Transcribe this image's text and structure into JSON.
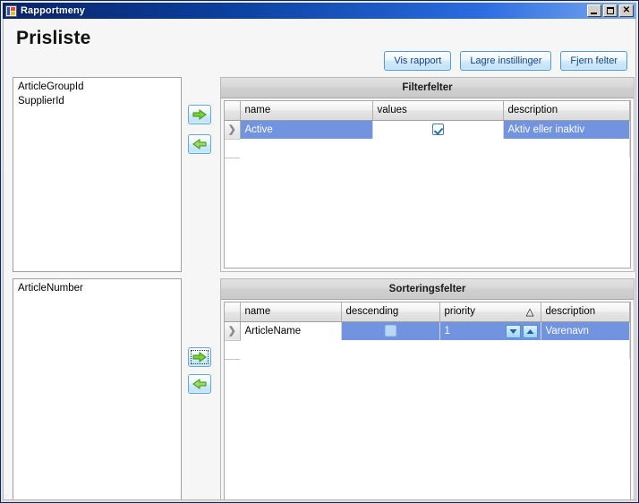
{
  "window": {
    "title": "Rapportmeny",
    "icon": "report-window-icon",
    "controls": {
      "minimize": "minimize-button",
      "maximize": "maximize-button",
      "close": "close-button",
      "close_glyph": "✕"
    }
  },
  "page": {
    "title": "Prisliste"
  },
  "toolbar": {
    "buttons": [
      {
        "label": "Vis rapport",
        "name": "show-report-button"
      },
      {
        "label": "Lagre instillinger",
        "name": "save-settings-button"
      },
      {
        "label": "Fjern felter",
        "name": "clear-fields-button"
      }
    ]
  },
  "available_filters": {
    "name": "available-filter-fields-list",
    "items": [
      "ArticleGroupId",
      "SupplierId"
    ]
  },
  "available_sortfields": {
    "name": "available-sort-fields-list",
    "items": [
      "ArticleNumber"
    ]
  },
  "transfer_buttons": {
    "filter_add": "add-filter-field-button",
    "filter_remove": "remove-filter-field-button",
    "sort_add": "add-sort-field-button",
    "sort_remove": "remove-sort-field-button",
    "add_glyph": "arrow-right-green-icon",
    "remove_glyph": "arrow-left-green-icon"
  },
  "filter_panel": {
    "caption": "Filterfelter",
    "columns": [
      "name",
      "values",
      "description"
    ],
    "rows": [
      {
        "selected": true,
        "row_indicator": "❯",
        "name": "Active",
        "value_checked": true,
        "description": "Aktiv eller inaktiv"
      }
    ]
  },
  "sort_panel": {
    "caption": "Sorteringsfelter",
    "columns": [
      "name",
      "descending",
      "priority",
      "description"
    ],
    "sort_indicator_column": "priority",
    "sort_indicator_glyph": "△",
    "rows": [
      {
        "selected": true,
        "row_indicator": "❯",
        "name": "ArticleName",
        "descending_checked": false,
        "priority": "1",
        "description": "Varenavn"
      }
    ]
  },
  "colors": {
    "titlebar_start": "#0a246a",
    "titlebar_end": "#7aa9ef",
    "selection": "#7193e0",
    "button_border": "#4f9bd9",
    "button_text": "#15428b",
    "accent_green": "#66cc33"
  }
}
